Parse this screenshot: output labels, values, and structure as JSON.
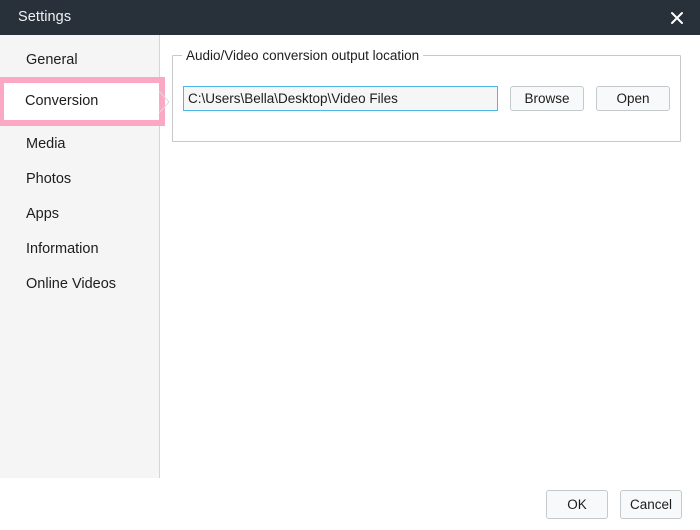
{
  "window": {
    "title": "Settings",
    "close_icon": "close-icon",
    "titlebar_color": "#283039"
  },
  "sidebar": {
    "selected": "Conversion",
    "highlight_color": "#fba8c4",
    "items": [
      {
        "label": "General"
      },
      {
        "label": "Conversion"
      },
      {
        "label": "Media"
      },
      {
        "label": "Photos"
      },
      {
        "label": "Apps"
      },
      {
        "label": "Information"
      },
      {
        "label": "Online Videos"
      }
    ]
  },
  "main": {
    "groupbox": {
      "legend": "Audio/Video conversion output location",
      "path_input": {
        "value": "C:\\Users\\Bella\\Desktop\\Video Files",
        "placeholder": "",
        "focus_color": "#4cb8e8"
      },
      "browse_label": "Browse",
      "open_label": "Open"
    }
  },
  "footer": {
    "ok_label": "OK",
    "cancel_label": "Cancel"
  }
}
